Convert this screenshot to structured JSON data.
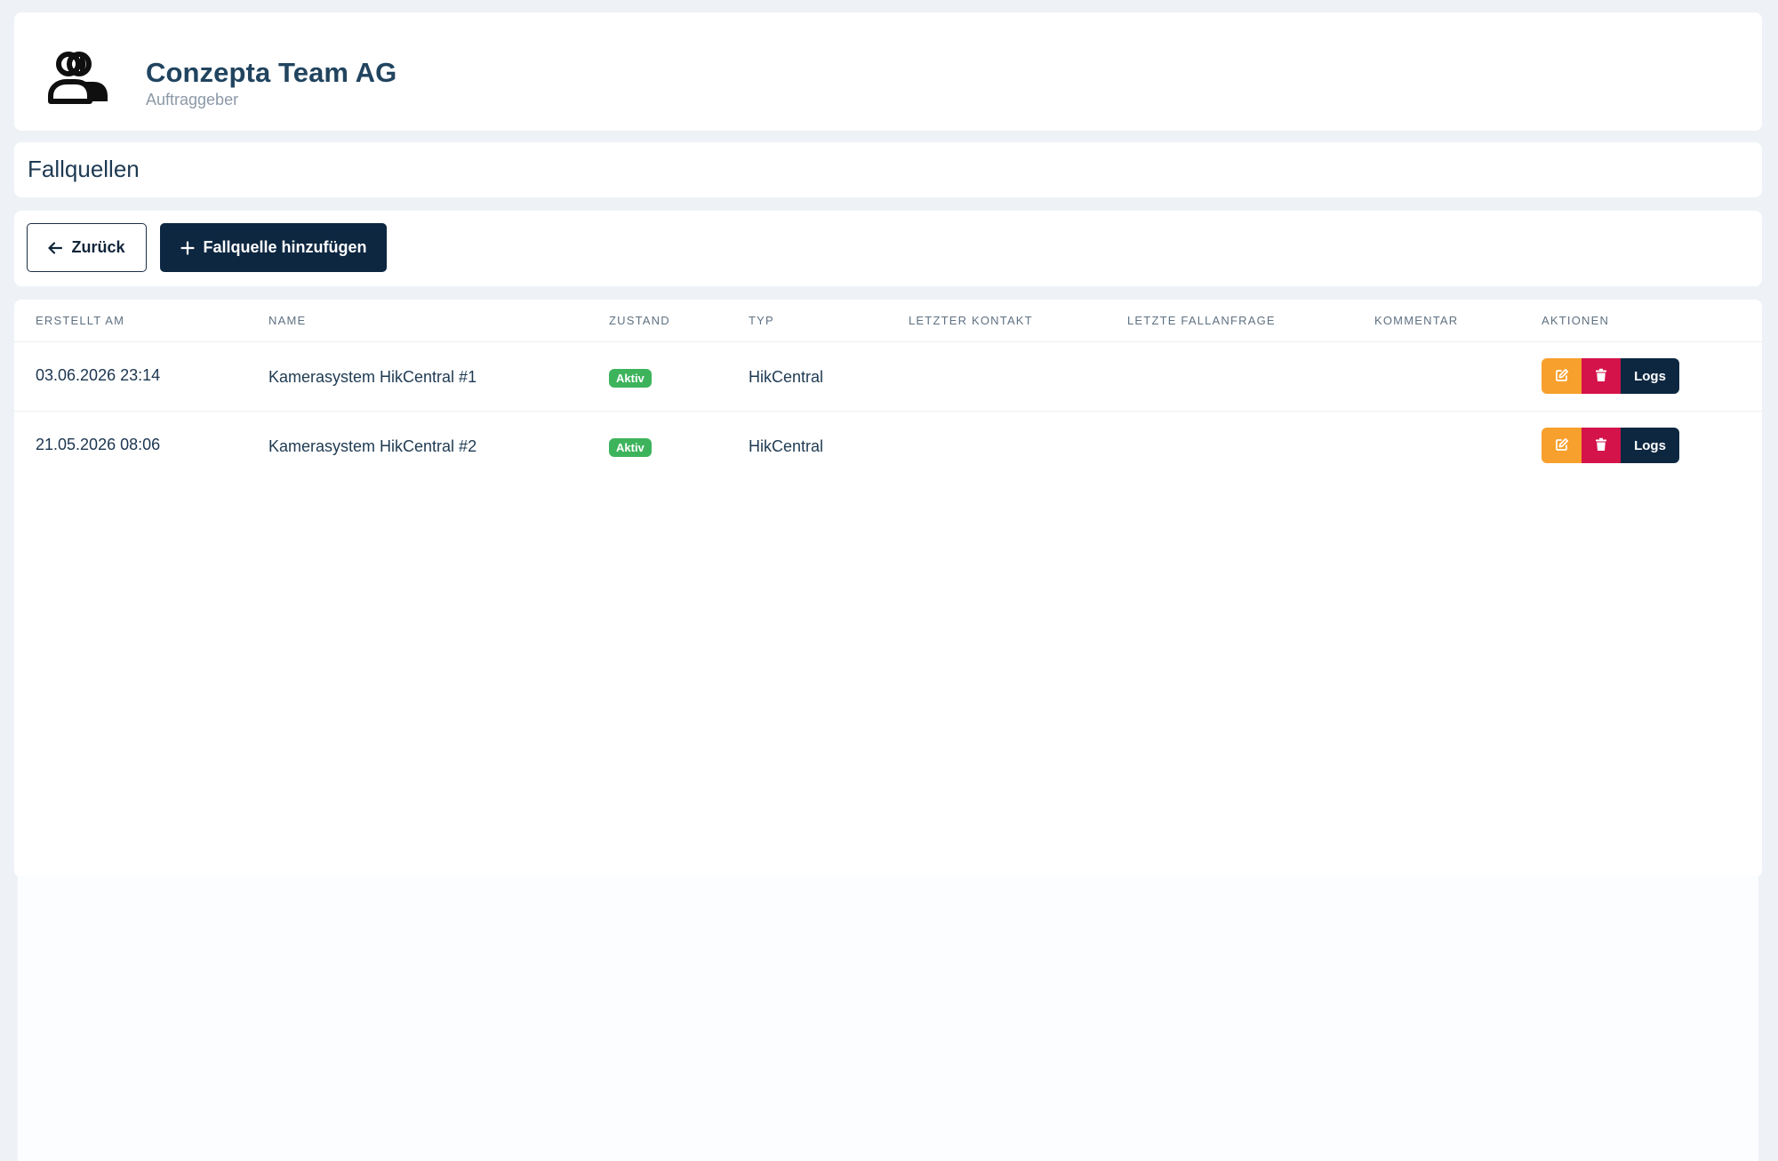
{
  "header": {
    "client_name": "Conzepta Team AG",
    "client_role": "Auftraggeber",
    "icon": "users-icon"
  },
  "page": {
    "title": "Fallquellen"
  },
  "toolbar": {
    "back_label": "Zurück",
    "back_icon": "arrow-left-icon",
    "add_label": "Fallquelle hinzufügen",
    "add_icon": "plus-icon"
  },
  "table": {
    "columns": [
      "ERSTELLT AM",
      "NAME",
      "ZUSTAND",
      "TYP",
      "LETZTER KONTAKT",
      "LETZTE FALLANFRAGE",
      "KOMMENTAR",
      "AKTIONEN"
    ],
    "rows": [
      {
        "created": "03.06.2026 23:14",
        "name": "Kamerasystem HikCentral #1",
        "status": "Aktiv",
        "type": "HikCentral",
        "last_contact": "",
        "last_request": "",
        "comment": "",
        "logs_label": "Logs"
      },
      {
        "created": "21.05.2026 08:06",
        "name": "Kamerasystem HikCentral #2",
        "status": "Aktiv",
        "type": "HikCentral",
        "last_contact": "",
        "last_request": "",
        "comment": "",
        "logs_label": "Logs"
      }
    ]
  },
  "colors": {
    "background": "#eef2f6",
    "primary_dark": "#0d2741",
    "status_active": "#3db45c",
    "edit": "#f7a02d",
    "delete": "#d4134a"
  }
}
